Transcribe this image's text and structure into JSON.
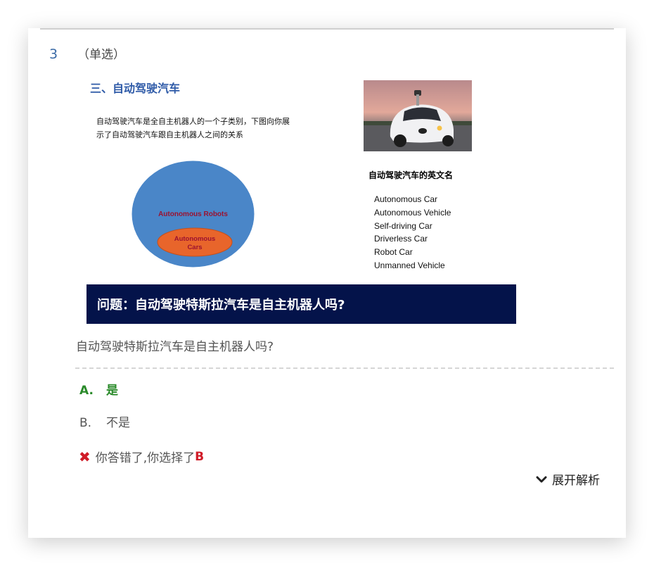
{
  "question": {
    "number": "3",
    "type_label": "（单选）",
    "text": "自动驾驶特斯拉汽车是自主机器人吗?"
  },
  "slide": {
    "title": "三、自动驾驶汽车",
    "description": "自动驾驶汽车是全自主机器人的一个子类别，下图向你展示了自动驾驶汽车跟自主机器人之间的关系",
    "venn": {
      "outer_label": "Autonomous Robots",
      "inner_label_line1": "Autonomous",
      "inner_label_line2": "Cars",
      "outer_color": "#4a86c8",
      "inner_color": "#e8652b",
      "label_color": "#9b1230"
    },
    "english_names_title": "自动驾驶汽车的英文名",
    "english_names": [
      "Autonomous Car",
      "Autonomous Vehicle",
      "Self-driving Car",
      "Driverless Car",
      "Robot Car",
      "Unmanned Vehicle"
    ],
    "banner": "问题：自动驾驶特斯拉汽车是自主机器人吗?"
  },
  "options": [
    {
      "letter": "A.",
      "text": "是",
      "correct": true
    },
    {
      "letter": "B.",
      "text": "不是",
      "correct": false
    }
  ],
  "result": {
    "icon": "x-icon",
    "text": "你答错了,你选择了",
    "chosen": "B"
  },
  "expand": {
    "icon": "chevron-down-icon",
    "label": "展开解析"
  },
  "colors": {
    "accent_blue": "#2f5ba8",
    "banner_bg": "#04134a",
    "correct_green": "#2a8a2a",
    "wrong_red": "#d01c28"
  }
}
